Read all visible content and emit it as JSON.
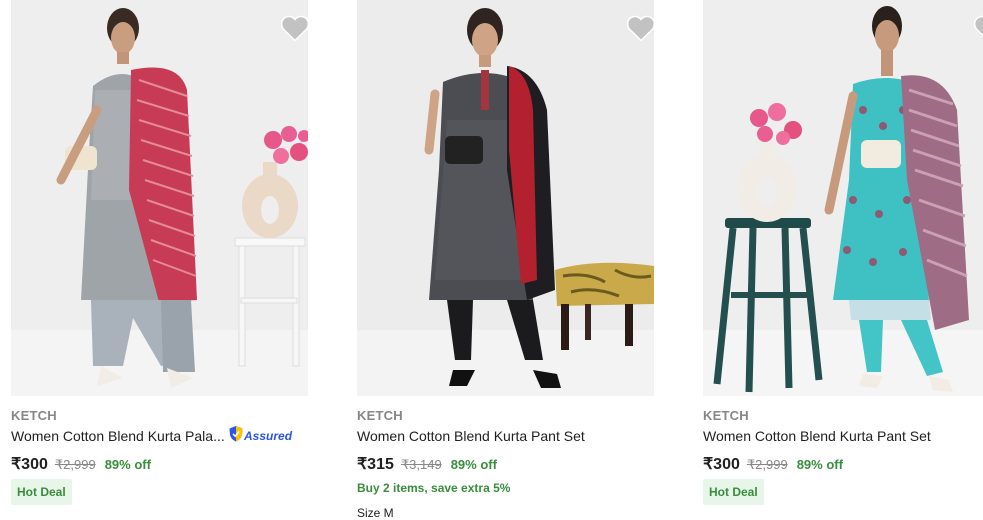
{
  "products": [
    {
      "brand": "KETCH",
      "title": "Women Cotton Blend Kurta Pala...",
      "assured_label": "Assured",
      "price": "₹300",
      "mrp": "₹2,999",
      "discount": "89% off",
      "badge": "Hot Deal",
      "image_icon": "product-photo-grey-kurta-red-dupatta"
    },
    {
      "brand": "KETCH",
      "title": "Women Cotton Blend Kurta Pant Set",
      "price": "₹315",
      "mrp": "₹3,149",
      "discount": "89% off",
      "offer": "Buy 2 items, save extra 5%",
      "sizes_label": "Size M",
      "image_icon": "product-photo-black-kurta-red-dupatta"
    },
    {
      "brand": "KETCH",
      "title": "Women Cotton Blend Kurta Pant Set",
      "price": "₹300",
      "mrp": "₹2,999",
      "discount": "89% off",
      "badge": "Hot Deal",
      "image_icon": "product-photo-teal-kurta-mauve-dupatta"
    }
  ],
  "colors": {
    "price_text": "#212121",
    "brand_text": "#878787",
    "discount_green": "#388e3c",
    "badge_bg": "#e8f5e9",
    "assured_blue": "#2a55e5",
    "wishlist_heart": "#c2c2c2"
  },
  "icons": {
    "wishlist": "heart-icon",
    "assured": "shield-check-icon"
  }
}
